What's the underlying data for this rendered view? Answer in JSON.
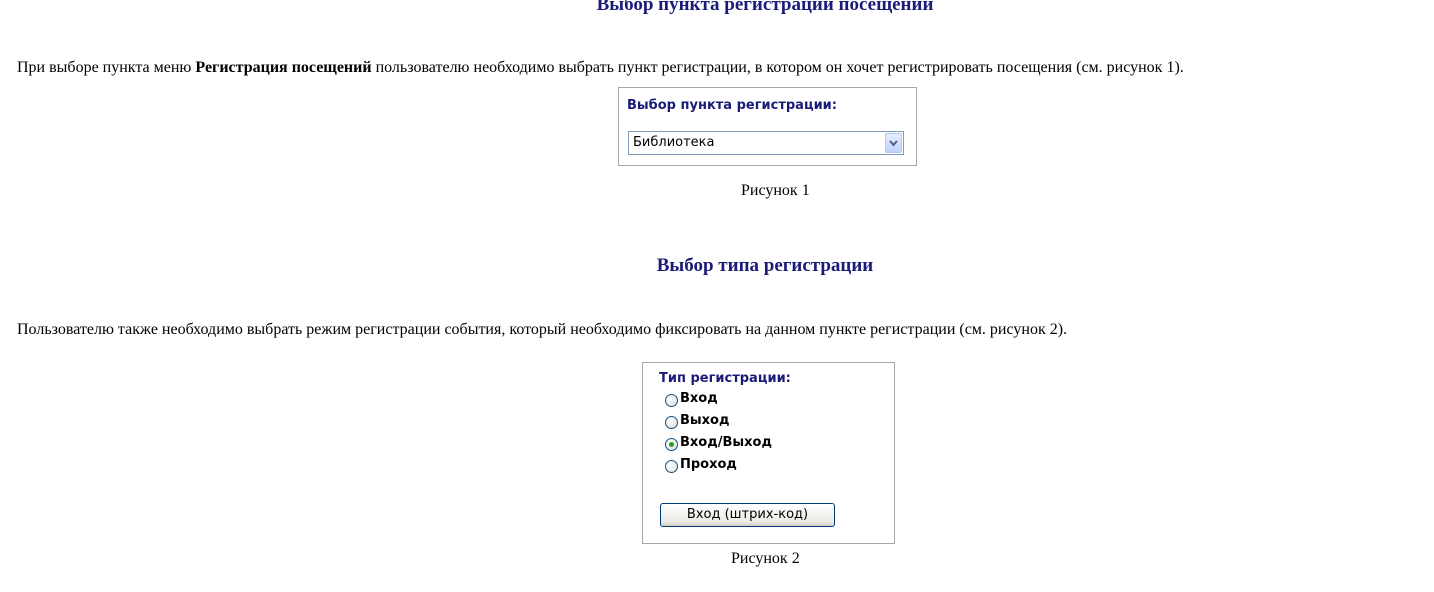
{
  "section1": {
    "title": "Выбор пункта регистрации посещений",
    "para_before": "При выборе пункта меню ",
    "para_bold": "Регистрация посещений",
    "para_after": " пользователю необходимо выбрать пункт регистрации, в котором он хочет регистрировать посещения (см. рисунок 1).",
    "figure": {
      "label": "Выбор пункта регистрации:",
      "select_value": "Библиотека",
      "dropdown_icon": "chevron-down-icon"
    },
    "caption": "Рисунок 1"
  },
  "section2": {
    "title": "Выбор типа регистрации",
    "para": "Пользователю также необходимо выбрать режим регистрации события, который необходимо фиксировать на данном пункте регистрации (см. рисунок 2).",
    "figure": {
      "label": "Тип регистрации:",
      "options": [
        "Вход",
        "Выход",
        "Вход/Выход",
        "Проход"
      ],
      "selected_index": 2,
      "button_label": "Вход (штрих-код)"
    },
    "caption": "Рисунок 2"
  }
}
